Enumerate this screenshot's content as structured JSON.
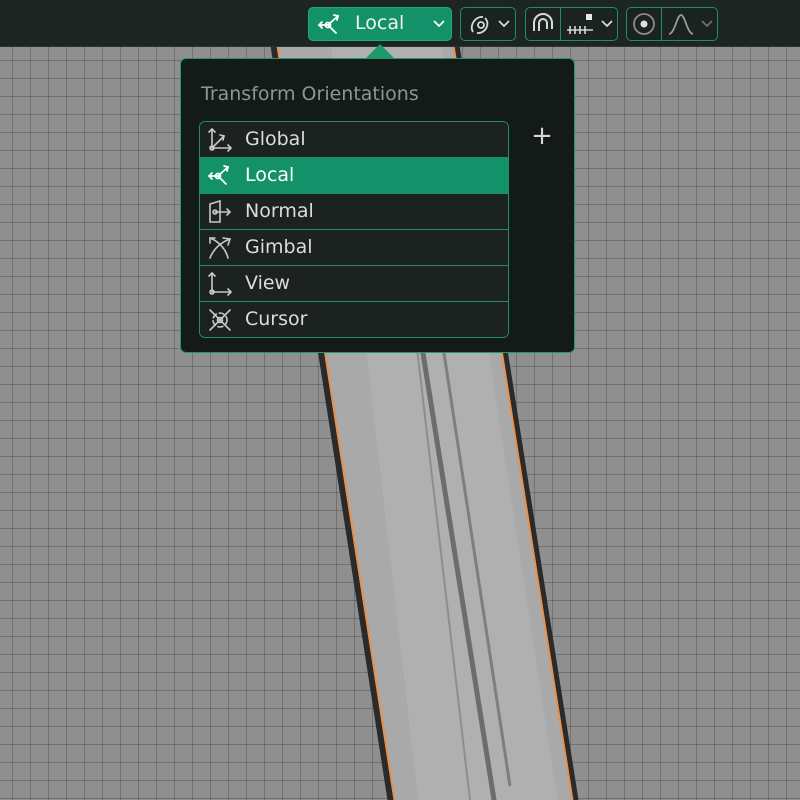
{
  "header": {
    "orientation_button": {
      "label": "Local",
      "icon": "local-orientation-icon"
    },
    "pivot_button": {
      "icon": "pivot-point-icon"
    },
    "snapping": {
      "magnet_icon": "magnet-icon",
      "increment_icon": "snap-increment-icon"
    },
    "proportional": {
      "toggle_icon": "proportional-editing-icon",
      "falloff_icon": "falloff-curve-icon"
    }
  },
  "popup": {
    "title": "Transform Orientations",
    "add_label": "+",
    "items": [
      {
        "label": "Global",
        "icon": "global-orientation-icon"
      },
      {
        "label": "Local",
        "icon": "local-orientation-icon",
        "active": true
      },
      {
        "label": "Normal",
        "icon": "normal-orientation-icon"
      },
      {
        "label": "Gimbal",
        "icon": "gimbal-orientation-icon"
      },
      {
        "label": "View",
        "icon": "view-orientation-icon"
      },
      {
        "label": "Cursor",
        "icon": "cursor-orientation-icon"
      }
    ]
  },
  "colors": {
    "accent": "#139168",
    "selection_outline": "#e8904a"
  }
}
